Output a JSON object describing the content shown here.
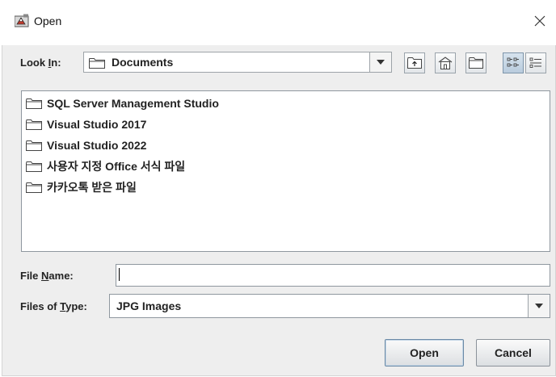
{
  "window": {
    "title": "Open",
    "close_icon": "close-icon",
    "app_icon": "java-duke-icon"
  },
  "look_in": {
    "label_pre": "Look ",
    "label_mnemonic": "I",
    "label_post": "n:",
    "value": "Documents"
  },
  "toolbar": {
    "buttons": [
      "up-one-level-icon",
      "home-icon",
      "new-folder-icon",
      "list-view-icon",
      "details-view-icon"
    ],
    "active": "list-view-icon"
  },
  "files": [
    "SQL Server Management Studio",
    "Visual Studio 2017",
    "Visual Studio 2022",
    "사용자 지정 Office 서식 파일",
    "카카오톡 받은 파일"
  ],
  "file_name": {
    "label_pre": "File ",
    "label_mnemonic": "N",
    "label_post": "ame:",
    "value": ""
  },
  "file_type": {
    "label_pre": "Files of ",
    "label_mnemonic": "T",
    "label_post": "ype:",
    "value": "JPG Images"
  },
  "buttons": {
    "open": "Open",
    "cancel": "Cancel"
  }
}
